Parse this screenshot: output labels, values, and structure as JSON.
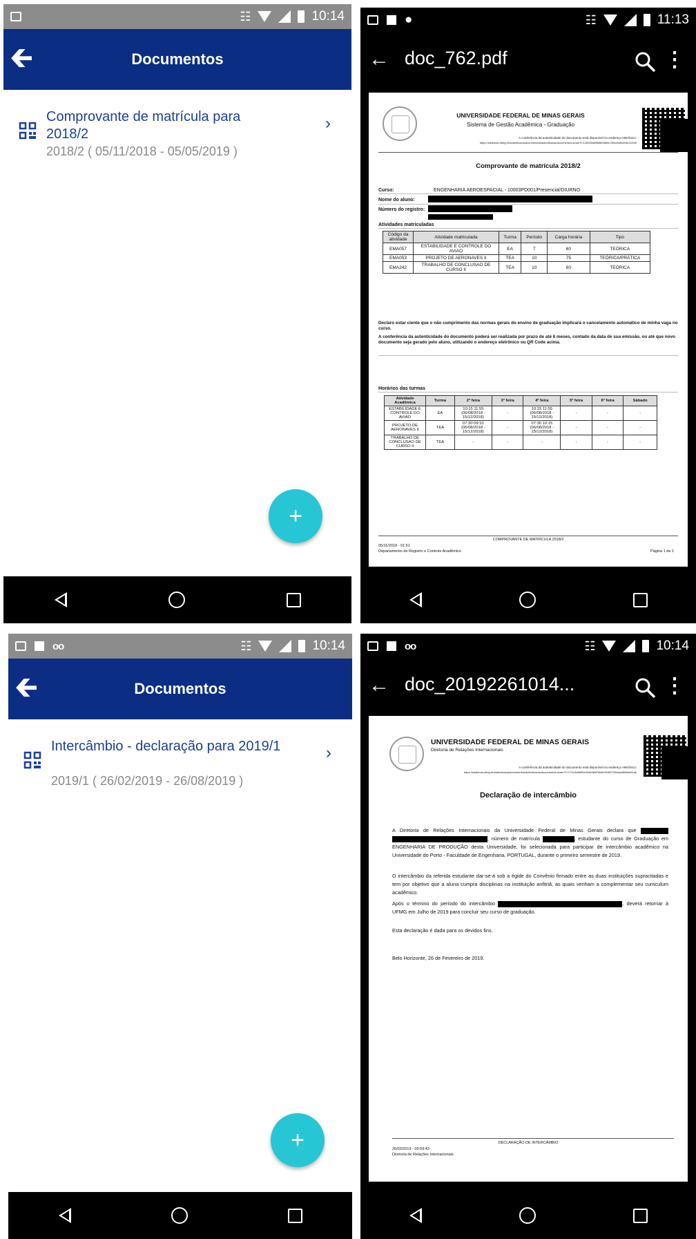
{
  "screen1": {
    "status_time": "10:14",
    "appbar_title": "Documentos",
    "item": {
      "title": "Comprovante de matrícula para 2018/2",
      "subtitle": "2018/2 ( 05/11/2018 - 05/05/2019 )"
    },
    "fab_label": "+"
  },
  "screen2": {
    "status_time": "11:13",
    "title": "doc_762.pdf",
    "pdf": {
      "university": "UNIVERSIDADE FEDERAL DE MINAS GERAIS",
      "system": "Sistema de Gestão Acadêmica - Graduação",
      "auth_note": "A conferência da autenticidade do documento está disponível no endereço eletrônico:",
      "auth_url": "https://sistemas.ufmg.br/autenticacaodocumentos/autenticacaodocumentos.seam?l=128240d8f6fd69389a7264d0e6c4f9e1124f9",
      "doc_title": "Comprovante de matrícula 2018/2",
      "curso_label": "Curso:",
      "curso_value": "ENGENHARIA AEROESPACIAL - 10003PD001/Presencial/DIURNO",
      "nome_label": "Nome do aluno:",
      "registro_label": "Número do registro:",
      "atividades_title": "Atividades matriculadas",
      "table_headers": [
        "Código da atividade",
        "Atividade matriculada",
        "Turma",
        "Período",
        "Carga horária",
        "Tipo"
      ],
      "table_rows": [
        [
          "EMA057",
          "ESTABILIDADE E CONTROLE DO AVIAO",
          "EA",
          "7",
          "60",
          "TEÓRICA"
        ],
        [
          "EMA053",
          "PROJETO DE AERONAVES II",
          "TEA",
          "10",
          "75",
          "TEÓRICA/PRÁTICA"
        ],
        [
          "EMA242",
          "TRABALHO DE CONCLUSAO DE CURSO II",
          "TEA",
          "10",
          "60",
          "TEÓRICA"
        ]
      ],
      "declaro": "Declaro estar ciente que o não cumprimento das normas gerais do ensino de graduação implicará o cancelamento automático de minha vaga no curso.",
      "conferencia": "A conferência da autenticidade do documento poderá ser realizada por prazo de até 6 meses, contado da data de sua emissão, ou até que novo documento seja gerado pelo aluno, utilizando o endereço eletrônico ou QR Code acima.",
      "horarios_title": "Horários das turmas",
      "horarios_headers": [
        "Atividade Acadêmica",
        "Turma",
        "2ª feira",
        "3ª feira",
        "4ª feira",
        "5ª feira",
        "6ª feira",
        "Sábado"
      ],
      "horarios_rows": [
        [
          "ESTABILIDADE E CONTROLE DO AVIAO",
          "EA",
          "10:15 11:55 (06/08/2018 - 15/12/2018)",
          "-",
          "10:15 11:55 (06/08/2018 - 15/12/2018)",
          "-",
          "-",
          "-"
        ],
        [
          "PROJETO DE AERONAVES II",
          "TEA",
          "07:30 09:10 (06/08/2018 - 15/12/2018)",
          "-",
          "07:30 10:15 (06/08/2018 - 15/12/2018)",
          "-",
          "-",
          "-"
        ],
        [
          "TRABALHO DE CONCLUSAO DE CURSO II",
          "TEA",
          "-",
          "-",
          "-",
          "-",
          "-",
          "-"
        ]
      ],
      "footer_center": "COMPROVANTE DE MATRÍCULA 2018/2",
      "footer_date": "05/11/2018 - 01:51",
      "footer_dept": "Departamento de Registro e Controle Acadêmico",
      "footer_page": "Página 1 de 1"
    }
  },
  "screen3": {
    "status_time": "10:14",
    "appbar_title": "Documentos",
    "item": {
      "title": "Intercâmbio - declaração para 2019/1",
      "subtitle": "2019/1 ( 26/02/2019 - 26/08/2019 )"
    },
    "fab_label": "+"
  },
  "screen4": {
    "status_time": "10:14",
    "title": "doc_20192261014...",
    "pdf": {
      "university": "UNIVERSIDADE FEDERAL DE MINAS GERAIS",
      "diretoria": "Diretoria de Relações Internacionais",
      "auth_note": "A conferência da autenticidade do documento está disponível no endereço eletrônico:",
      "auth_url": "https://sistemas.ufmg.br/autenticacaodocumentos/autenticacaodocumentos.seam?l=1723-5a5690e2edb084f3fb5e90280720baac6fb8ae61ab",
      "doc_title": "Declaração de intercâmbio",
      "p1_a": "A Diretoria de Relações Internacionais da Universidade Federal de Minas Gerais declara que",
      "p1_b": ", número de matrícula",
      "p1_c": ", estudante do curso de Graduação em ENGENHARIA DE PRODUÇÃO desta Universidade, foi selecionada para participar de intercâmbio acadêmico na Universidade do Porto - Faculdade de Engenharia, PORTUGAL, durante o primeiro semestre de 2019.",
      "p2": "O intercâmbio da referida estudante dar-se-á sob a égide do Convênio firmado entre as duas instituições supracitadas e tem por objetivo que a aluna cumpra disciplinas na instituição anfitriã, as quais venham a complementar seu curriculum acadêmico.",
      "p3_a": "Após o término do período do intercâmbio",
      "p3_b": ", deverá retornar à UFMG em Julho de 2019 para concluir seu curso de graduação.",
      "p4": "Esta declaração é dada para os devidos fins.",
      "p5": "Belo Horizonte, 26 de Fevereiro de 2019.",
      "footer_center": "DECLARAÇÃO DE INTERCÂMBIO",
      "footer_date": "26/02/2019 - 09:59:43",
      "footer_dept": "Diretoria de Relações Internacionais"
    }
  },
  "colors": {
    "appbar": "#0b2e84",
    "item_title": "#1d3f9c",
    "fab": "#26c6d4"
  },
  "icons": [
    "back-arrow-icon",
    "qr-code-icon",
    "chevron-right-icon",
    "add-icon",
    "search-icon",
    "more-vert-icon",
    "nav-back-icon",
    "nav-home-icon",
    "nav-recents-icon"
  ]
}
